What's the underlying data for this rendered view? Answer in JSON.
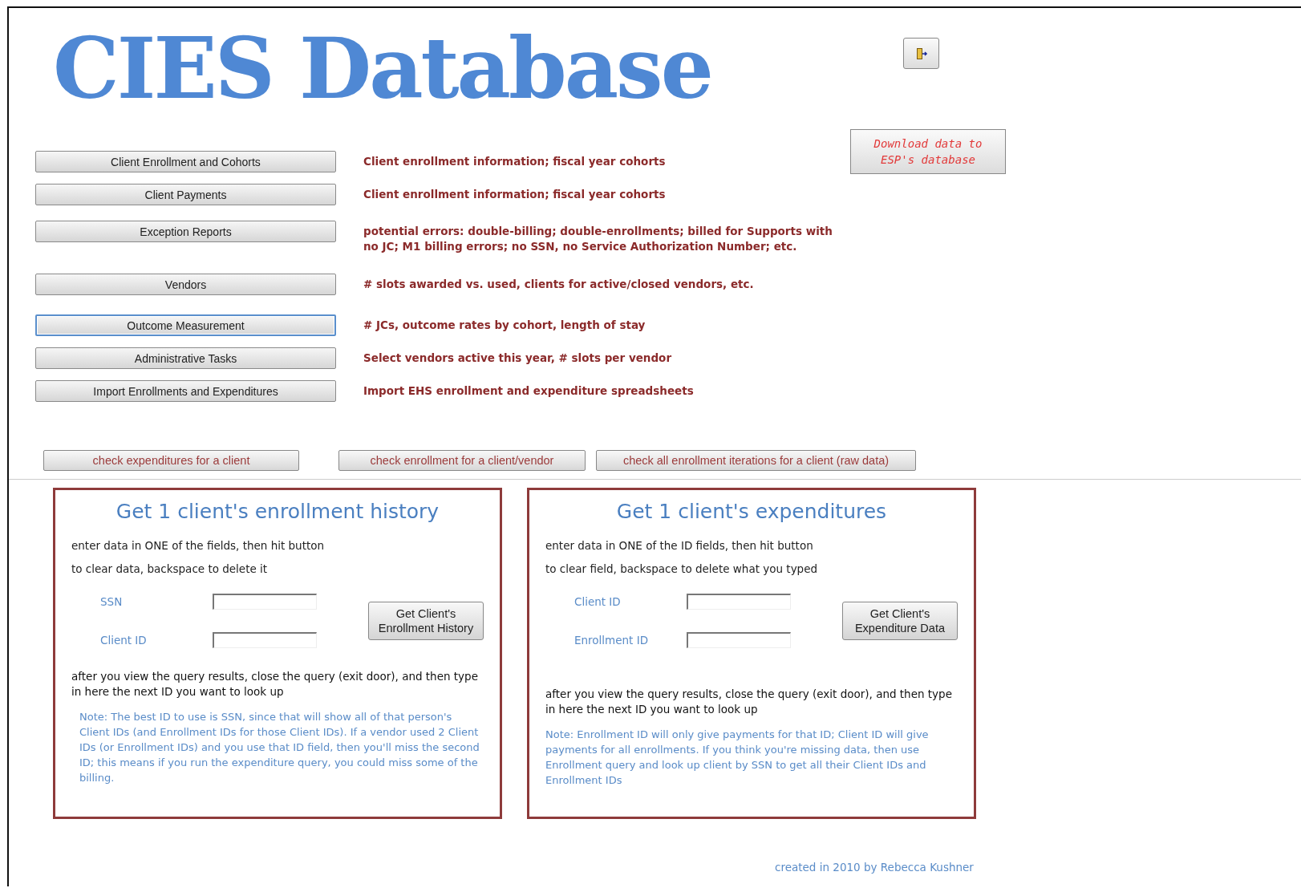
{
  "title": "CIES Database",
  "menu": [
    {
      "label": "Client Enrollment and Cohorts",
      "focused": false,
      "description": "Client enrollment information; fiscal year cohorts"
    },
    {
      "label": "Client Payments",
      "focused": false,
      "description": "Client enrollment information; fiscal year cohorts"
    },
    {
      "label": "Exception Reports",
      "focused": false,
      "description": "potential errors:  double-billing; double-enrollments; billed for Supports with no JC; M1 billing errors; no SSN, no Service Authorization Number; etc."
    },
    {
      "label": "Vendors",
      "focused": false,
      "description": "# slots awarded vs. used, clients for active/closed vendors, etc."
    },
    {
      "label": "Outcome Measurement",
      "focused": true,
      "description": "# JCs, outcome rates by cohort, length of stay"
    },
    {
      "label": "Administrative Tasks",
      "focused": false,
      "description": "Select vendors active this year, # slots per vendor"
    },
    {
      "label": "Import Enrollments and Expenditures",
      "focused": false,
      "description": "Import EHS enrollment and expenditure spreadsheets"
    }
  ],
  "download_button": "Download data to ESP's database",
  "check_buttons": [
    "check expenditures for a client",
    "check enrollment for a client/vendor",
    "check all enrollment iterations for a client (raw data)"
  ],
  "panels": [
    {
      "title": "Get 1 client's enrollment history",
      "instructions": [
        "enter data in ONE of the fields, then hit button",
        "to clear data, backspace to delete it"
      ],
      "fields": [
        {
          "label": "SSN"
        },
        {
          "label": "Client ID"
        }
      ],
      "button": "Get Client's Enrollment History",
      "after": "after you view the query results, close the query (exit door), and then type in here the next ID you want to look up",
      "note": "Note:  The best ID to use is SSN, since that will show all of that person's Client IDs (and Enrollment IDs for those Client IDs).  If a vendor used 2 Client IDs (or Enrollment IDs) and you use that ID field, then you'll miss the second ID; this means if you run the expenditure query, you could miss some of the billing."
    },
    {
      "title": "Get 1 client's expenditures",
      "instructions": [
        "enter data in ONE of the ID fields, then hit button",
        "to clear field, backspace to delete what you typed"
      ],
      "fields": [
        {
          "label": "Client ID"
        },
        {
          "label": "Enrollment ID"
        }
      ],
      "button": "Get Client's Expenditure Data",
      "after": "after you view the query results, close the query (exit door), and then type in here the next ID you want to look up",
      "note": "Note:  Enrollment ID will only give payments for that ID; Client ID will give payments for all enrollments.  If you think you're missing data, then use Enrollment query and look up client by SSN to get all their Client IDs and Enrollment IDs"
    }
  ],
  "footer": "created in 2010 by Rebecca Kushner"
}
